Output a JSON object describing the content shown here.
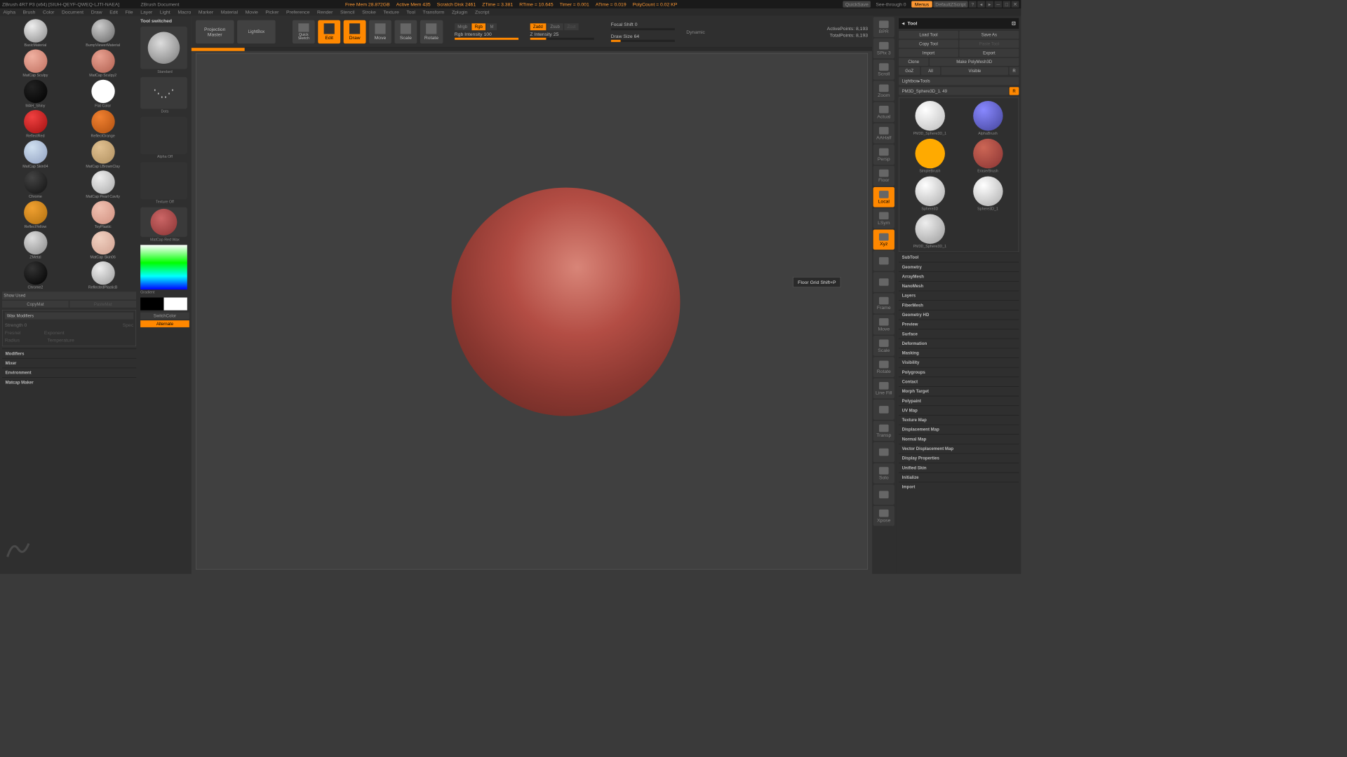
{
  "titlebar": {
    "app": "ZBrush 4R7 P3 (x64) [SIUH-QEYF-QWEQ-LJTI-NAEA]",
    "doc": "ZBrush Document",
    "stats": [
      "Free Mem 28.872GB",
      "Active Mem 435",
      "Scratch Disk 2461",
      "ZTime = 3.381",
      "RTime = 10.645",
      "Timer = 0.001",
      "ATime = 0.019",
      "PolyCount = 0.02 KP"
    ],
    "quicksave": "QuickSave",
    "seethrough": "See-through 0",
    "menus": "Menus",
    "layout": "DefaultZScript"
  },
  "menubar": [
    "Alpha",
    "Brush",
    "Color",
    "Document",
    "Draw",
    "Edit",
    "File",
    "Layer",
    "Light",
    "Macro",
    "Marker",
    "Material",
    "Movie",
    "Picker",
    "Preference",
    "Render",
    "Stencil",
    "Stroke",
    "Texture",
    "Tool",
    "Transform",
    "Zplugin",
    "Zscript"
  ],
  "status": "Tool switched",
  "topbar": {
    "projection": "Projection\nMaster",
    "lightbox": "LightBox",
    "quicksketch": "Quick\nSketch",
    "edit": "Edit",
    "draw": "Draw",
    "move": "Move",
    "scale": "Scale",
    "rotate": "Rotate",
    "mrgb": "Mrgb",
    "rgb": "Rgb",
    "m": "M",
    "rgbint": "Rgb Intensity 100",
    "zadd": "Zadd",
    "zsub": "Zsub",
    "zcut": "Zcut",
    "zint": "Z Intensity 25",
    "focal": "Focal Shift 0",
    "drawsize": "Draw Size 64",
    "dynamic": "Dynamic",
    "active": "ActivePoints: 8,193",
    "total": "TotalPoints: 8,193"
  },
  "materials": [
    {
      "name": "BasicMaterial",
      "bg": "radial-gradient(circle at 35% 30%, #eee, #888)"
    },
    {
      "name": "BumpViewerMaterial",
      "bg": "radial-gradient(circle at 35% 30%, #ccc, #666)"
    },
    {
      "name": "MatCap Sculpy",
      "bg": "radial-gradient(circle at 35% 30%, #f0b0a0, #c07060)"
    },
    {
      "name": "MatCap Sculpy2",
      "bg": "radial-gradient(circle at 35% 30%, #e8a090, #b06050)"
    },
    {
      "name": "MAH_Shiny",
      "bg": "radial-gradient(circle at 35% 30%, #222, #000)"
    },
    {
      "name": "Flat Color",
      "bg": "#fff"
    },
    {
      "name": "ReflectRed",
      "bg": "radial-gradient(circle at 35% 30%, #f04040, #a01010)"
    },
    {
      "name": "ReflectOrange",
      "bg": "radial-gradient(circle at 35% 30%, #f08030, #b05010)"
    },
    {
      "name": "MatCap Skin04",
      "bg": "radial-gradient(circle at 35% 30%, #d0e0f0, #90a0c0)"
    },
    {
      "name": "MatCap LBrownClay",
      "bg": "radial-gradient(circle at 35% 30%, #e0c090, #b09060)"
    },
    {
      "name": "Chrome",
      "bg": "radial-gradient(circle at 35% 30%, #444, #111)"
    },
    {
      "name": "MatCap Pearl Cavity",
      "bg": "radial-gradient(circle at 35% 30%, #eee, #aaa)"
    },
    {
      "name": "ReflectYellow",
      "bg": "radial-gradient(circle at 35% 30%, #f0a030, #b07010)"
    },
    {
      "name": "ToyPlastic",
      "bg": "radial-gradient(circle at 35% 30%, #f0c0b0, #d09080)"
    },
    {
      "name": "ZMetal",
      "bg": "radial-gradient(circle at 35% 30%, #ddd, #888)"
    },
    {
      "name": "MatCap Skin06",
      "bg": "radial-gradient(circle at 35% 30%, #f0d0c0, #d0a090)"
    },
    {
      "name": "Chrome2",
      "bg": "radial-gradient(circle at 35% 30%, #333, #000)"
    },
    {
      "name": "ReflectedPlasticB",
      "bg": "radial-gradient(circle at 35% 30%, #eee, #999)"
    }
  ],
  "matpanel": {
    "showused": "Show Used",
    "copy": "CopyMat",
    "paste": "PasteMat",
    "wax": "Wax Modifiers",
    "strength": "Strength 0",
    "fresnel": "Fresnel",
    "exponent": "Exponent",
    "radius": "Radius",
    "temperature": "Temperature",
    "sections": [
      "Modifiers",
      "Mixer",
      "Environment",
      "Matcap Maker"
    ]
  },
  "brushcol": {
    "standard": "Standard",
    "dots": "Dots",
    "alpha": "Alpha Off",
    "texture": "Texture Off",
    "matcap": "MatCap Red Wax",
    "gradient": "Gradient",
    "switch": "SwitchColor",
    "alternate": "Alternate"
  },
  "tooltip": "Floor Grid   Shift+P",
  "righttools": [
    "BPR",
    "SPix 3",
    "Scroll",
    "Zoom",
    "Actual",
    "AAHalf",
    "Persp",
    "Floor",
    "Local",
    "LSym",
    "Xyz",
    "",
    "",
    "Frame",
    "Move",
    "Scale",
    "Rotate",
    "Line Fill",
    "",
    "Transp",
    "",
    "Solo",
    "",
    "Xpose"
  ],
  "rightpanel": {
    "title": "Tool",
    "row1": {
      "load": "Load Tool",
      "save": "Save As"
    },
    "row2": {
      "copy": "Copy Tool",
      "paste": "Paste Tool"
    },
    "row3": {
      "import": "Import",
      "export": "Export"
    },
    "row4": {
      "clone": "Clone",
      "make": "Make PolyMesh3D"
    },
    "row5": {
      "goz": "GoZ",
      "all": "All",
      "visible": "Visible",
      "r": "R"
    },
    "lightbox": "Lightbox▸Tools",
    "toolname": "PM3D_Sphere3D_1. 49",
    "tools": [
      {
        "name": "PM3D_Sphere3D_1",
        "bg": "radial-gradient(circle at 35% 30%,#fff,#bbb)"
      },
      {
        "name": "AlphaBrush",
        "bg": "radial-gradient(circle at 35% 30%,#88f,#449)"
      },
      {
        "name": "SimpleBrush",
        "bg": "#ffaa00"
      },
      {
        "name": "EraserBrush",
        "bg": "radial-gradient(circle at 35% 30%,#c65,#833)"
      },
      {
        "name": "Sphere3D",
        "bg": "radial-gradient(circle at 35% 30%,#fff,#aaa)"
      },
      {
        "name": "Sphere3D_1",
        "bg": "radial-gradient(circle at 35% 30%,#fff,#aaa)"
      },
      {
        "name": "PM3D_Sphere3D_1",
        "bg": "radial-gradient(circle at 35% 30%,#eee,#999)"
      }
    ],
    "sections": [
      "SubTool",
      "Geometry",
      "ArrayMesh",
      "NanoMesh",
      "Layers",
      "FiberMesh",
      "Geometry HD",
      "Preview",
      "Surface",
      "Deformation",
      "Masking",
      "Visibility",
      "Polygroups",
      "Contact",
      "Morph Target",
      "Polypaint",
      "UV Map",
      "Texture Map",
      "Displacement Map",
      "Normal Map",
      "Vector Displacement Map",
      "Display Properties",
      "Unified Skin",
      "Initialize",
      "Import"
    ]
  }
}
